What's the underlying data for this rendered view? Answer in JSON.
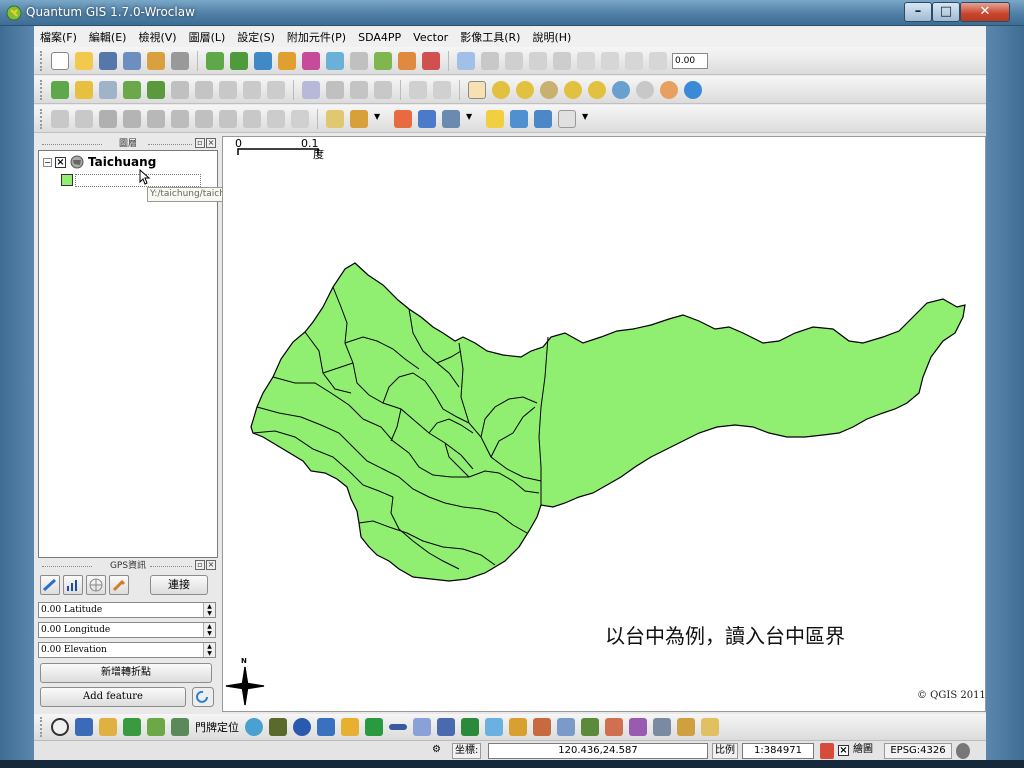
{
  "window": {
    "title": "Quantum GIS 1.7.0-Wroclaw"
  },
  "menu": [
    "檔案(F)",
    "編輯(E)",
    "檢視(V)",
    "圖層(L)",
    "設定(S)",
    "附加元件(P)",
    "SDA4PP",
    "Vector",
    "影像工具(R)",
    "說明(H)"
  ],
  "toolbar": {
    "zoom_value": "0.00"
  },
  "layers_panel": {
    "title": "圖層",
    "layer_name": "Taichuang",
    "tooltip": "Y:/taichung/taichuang.shp"
  },
  "gps_panel": {
    "title": "GPS資訊",
    "connect_label": "連接",
    "latitude": "0.00 Latitude",
    "longitude": "0.00 Longitude",
    "elevation": "0.00 Elevation",
    "add_vertex_label": "新增轉折點",
    "add_feature_label": "Add feature"
  },
  "map": {
    "scale_zero": "0",
    "scale_value": "0.1",
    "scale_unit": "度",
    "north_label": "N",
    "annotation": "以台中為例，讀入台中區界",
    "copyright": "© QGIS 2011",
    "fill_color": "#90ee70"
  },
  "bottom_toolbar": {
    "locator_label": "門牌定位"
  },
  "status": {
    "coord_label": "坐標:",
    "coord_value": "120.436,24.587",
    "scale_label": "比例",
    "scale_value": "1:384971",
    "render_label": "繪圖",
    "crs": "EPSG:4326"
  }
}
